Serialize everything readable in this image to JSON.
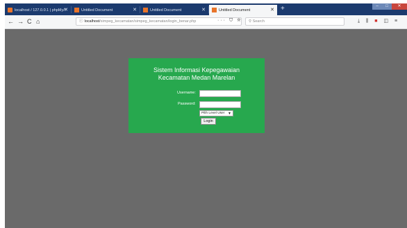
{
  "browser": {
    "tabs": [
      {
        "label": "localhost / 127.0.0.1 | phpMy/\\",
        "active": false,
        "icon": "phpmyadmin-icon"
      },
      {
        "label": "Untitled Document",
        "active": false,
        "icon": "document-icon"
      },
      {
        "label": "Untitled Document",
        "active": false,
        "icon": "document-icon"
      },
      {
        "label": "Untitled Document",
        "active": true,
        "icon": "document-icon"
      }
    ],
    "new_tab": "+",
    "nav": {
      "back": "←",
      "forward": "→",
      "reload": "C",
      "home": "⌂"
    },
    "url": {
      "host": "localhost",
      "path": "/simpeg_kecamatan/simpeg_kecamatan/login_benar.php"
    },
    "url_actions": "··· ⛉ ☆",
    "search_placeholder": "Search",
    "toolbar": {
      "download": "⤓",
      "library": "⫼",
      "menu": "≡"
    }
  },
  "login": {
    "title_line1": "Sistem Informasi Kepegawaian",
    "title_line2": "Kecamatan Medan Marelan",
    "username_label": "Username:",
    "password_label": "Password:",
    "level_select_value": "Pilih Level User",
    "login_button": "Login"
  },
  "colors": {
    "page_background": "#6a6a6a",
    "panel_background": "#27a84e",
    "tab_bar": "#1b3a6e"
  }
}
